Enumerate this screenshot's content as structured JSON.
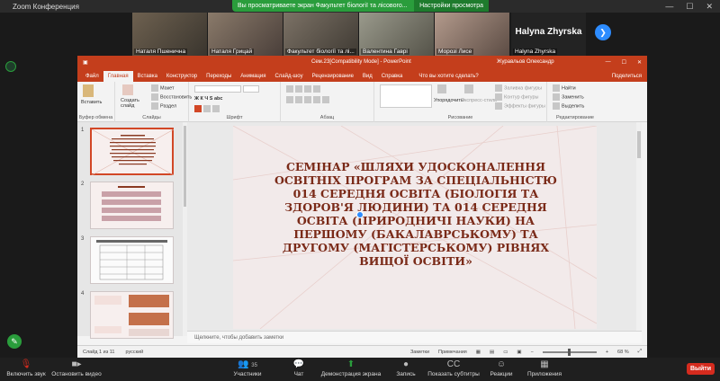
{
  "zoom": {
    "window_title": "Zoom Конференция",
    "share_banner": "Вы просматриваете экран Факультет біології та лісового...",
    "view_options": "Настройки просмотра",
    "participants": [
      {
        "name": "Наталя Пшенична"
      },
      {
        "name": "Наталя Грицай"
      },
      {
        "name": "Факультет біології та лі..."
      },
      {
        "name": "Валентина Гаврі"
      },
      {
        "name": "Морозі Лисе"
      },
      {
        "name": "Halyna Zhyrska",
        "display": "Halyna Zhyrska"
      }
    ],
    "controls": {
      "audio": "Включить звук",
      "video": "Остановить видео",
      "participants": "Участники",
      "participants_count": "35",
      "chat": "Чат",
      "share": "Демонстрация экрана",
      "record": "Запись",
      "subtitles": "Показать субтитры",
      "reactions": "Реакции",
      "apps": "Приложения",
      "leave": "Выйти"
    }
  },
  "ppt": {
    "doc_title": "Сем.2З[Compatibility Mode] - PowerPoint",
    "user": "Журавльов Олександр",
    "tabs": [
      "Файл",
      "Главная",
      "Вставка",
      "Конструктор",
      "Переходы",
      "Анимация",
      "Слайд-шоу",
      "Рецензирование",
      "Вид",
      "Справка"
    ],
    "search": "Что вы хотите сделать?",
    "share": "Поделиться",
    "ribbon": {
      "clipboard": "Буфер обмена",
      "paste": "Вставить",
      "slides": "Слайды",
      "new_slide": "Создать слайд",
      "layout": "Макет",
      "reset": "Восстановить",
      "section": "Раздел",
      "font": "Шрифт",
      "paragraph": "Абзац",
      "drawing": "Рисование",
      "arrange": "Упорядочить",
      "quick_styles": "Экспресс-стили",
      "shape_fill": "Заливка фигуры",
      "shape_outline": "Контур фигуры",
      "shape_effects": "Эффекты фигуры",
      "editing": "Редактирование",
      "find": "Найти",
      "replace": "Заменить",
      "select": "Выделить"
    },
    "slide_numbers": [
      "1",
      "2",
      "3",
      "4"
    ],
    "slide_text": "СЕМІНАР «ШЛЯХИ УДОСКОНАЛЕННЯ ОСВІТНІХ ПРОГРАМ ЗА СПЕЦІАЛЬНІСТЮ 014 СЕРЕДНЯ ОСВІТА (БІОЛОГІЯ ТА ЗДОРОВ'Я ЛЮДИНИ) ТА 014 СЕРЕДНЯ ОСВІТА (ПРИРОДНИЧІ НАУКИ) НА ПЕРШОМУ (БАКАЛАВРСЬКОМУ) ТА ДРУГОМУ (МАГІСТЕРСЬКОМУ) РІВНЯХ ВИЩОЇ ОСВІТИ»",
    "notes_placeholder": "Щелкните, чтобы добавить заметки",
    "status": {
      "slide_info": "Слайд 1 из 11",
      "language": "русский",
      "notes": "Заметки",
      "comments": "Примечания",
      "zoom_level": "68 %"
    }
  }
}
